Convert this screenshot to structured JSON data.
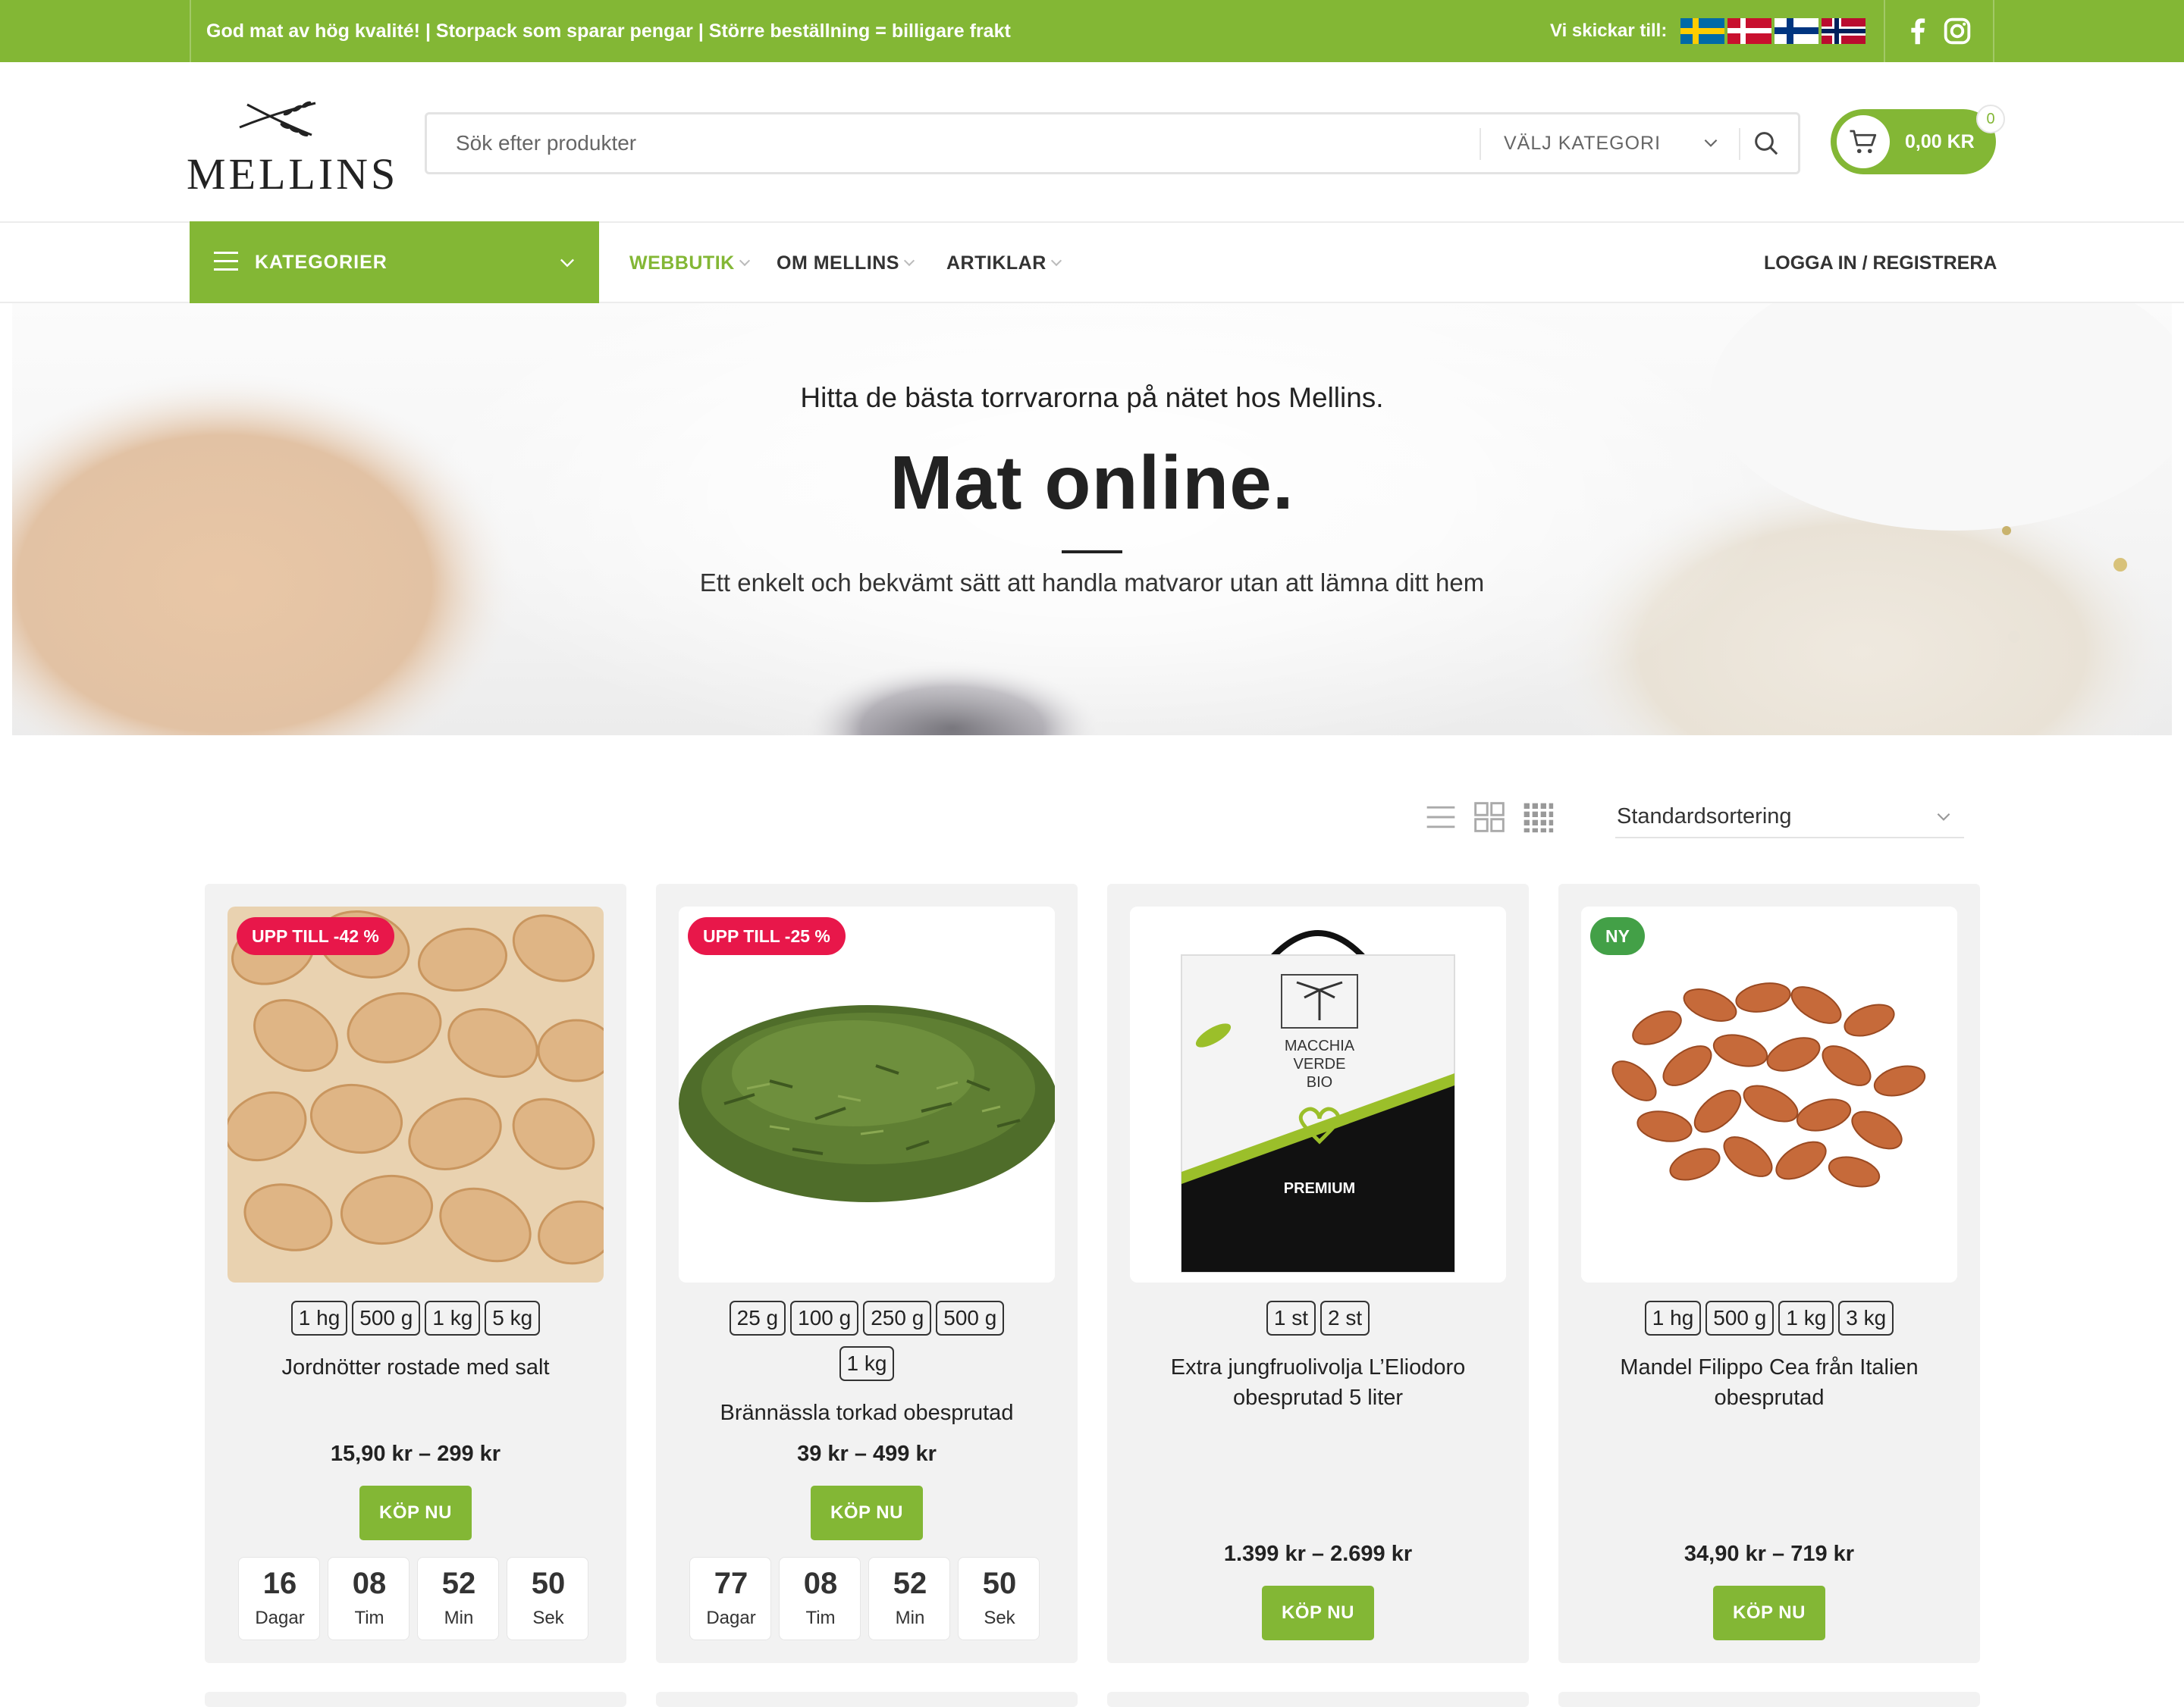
{
  "topbar": {
    "promo": "God mat av hög kvalité! | Storpack som sparar pengar | Större beställning = billigare frakt",
    "ship_label": "Vi skickar till:",
    "flags": [
      "sweden-flag",
      "denmark-flag",
      "finland-flag",
      "norway-flag"
    ],
    "social": [
      "facebook-icon",
      "instagram-icon"
    ]
  },
  "header": {
    "logo_text": "MELLINS",
    "search_placeholder": "Sök efter produkter",
    "category_select": "VÄLJ KATEGORI",
    "cart_amount": "0,00 KR",
    "cart_count": "0"
  },
  "nav": {
    "categories_label": "KATEGORIER",
    "items": [
      "WEBBUTIK",
      "OM MELLINS",
      "ARTIKLAR"
    ],
    "login": "LOGGA IN / REGISTRERA"
  },
  "hero": {
    "subtitle": "Hitta de bästa torrvarorna på nätet hos Mellins.",
    "title": "Mat online.",
    "description": "Ett enkelt och bekvämt sätt att handla matvaror utan att lämna ditt hem"
  },
  "toolbar": {
    "sort_label": "Standardsortering"
  },
  "colors": {
    "brand_green": "#83b735",
    "sale_badge": "#e8174a",
    "new_badge": "#43a047"
  },
  "products": [
    {
      "badge": "UPP TILL -42 %",
      "variants": [
        "1 hg",
        "500 g",
        "1 kg",
        "5 kg"
      ],
      "name": "Jordnötter rostade med salt",
      "price": "15,90 kr – 299 kr",
      "buy": "KÖP NU",
      "countdown": [
        {
          "value": "16",
          "unit": "Dagar"
        },
        {
          "value": "08",
          "unit": "Tim"
        },
        {
          "value": "52",
          "unit": "Min"
        },
        {
          "value": "50",
          "unit": "Sek"
        }
      ]
    },
    {
      "badge": "UPP TILL -25 %",
      "variants": [
        "25 g",
        "100 g",
        "250 g",
        "500 g",
        "1 kg"
      ],
      "name": "Brännässla torkad obesprutad",
      "price": "39 kr – 499 kr",
      "buy": "KÖP NU",
      "countdown": [
        {
          "value": "77",
          "unit": "Dagar"
        },
        {
          "value": "08",
          "unit": "Tim"
        },
        {
          "value": "52",
          "unit": "Min"
        },
        {
          "value": "50",
          "unit": "Sek"
        }
      ]
    },
    {
      "variants": [
        "1 st",
        "2 st"
      ],
      "name": "Extra jungfruolivolja L’Eliodoro obesprutad 5 liter",
      "price": "1.399 kr – 2.699 kr",
      "buy": "KÖP NU",
      "package_text": [
        "MACCHIA",
        "VERDE",
        "BIO",
        "PREMIUM"
      ]
    },
    {
      "badge": "NY",
      "variants": [
        "1 hg",
        "500 g",
        "1 kg",
        "3 kg"
      ],
      "name": "Mandel Filippo Cea från Italien obesprutad",
      "price": "34,90 kr – 719 kr",
      "buy": "KÖP NU"
    }
  ]
}
